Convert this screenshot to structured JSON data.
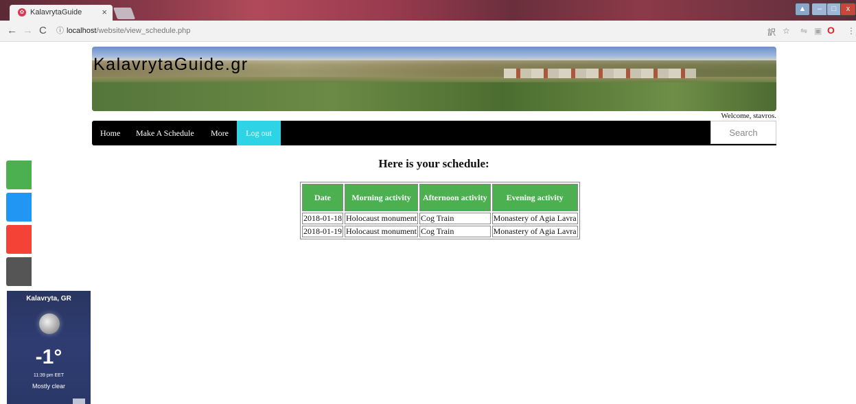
{
  "browser": {
    "tab_title": "KalavrytaGuide",
    "tab_close": "×",
    "url_host": "localhost",
    "url_path": "/website/view_schedule.php"
  },
  "site": {
    "logo": "KalavrytaGuide.gr",
    "welcome": "Welcome, stavros.",
    "nav": {
      "home": "Home",
      "make_schedule": "Make A Schedule",
      "more": "More",
      "logout": "Log out"
    },
    "search_placeholder": "Search"
  },
  "schedule": {
    "heading": "Here is your schedule:",
    "columns": [
      "Date",
      "Morning activity",
      "Afternoon activity",
      "Evening activity"
    ],
    "rows": [
      [
        "2018-01-18",
        "Holocaust monument",
        "Cog Train",
        "Monastery of Agia Lavra"
      ],
      [
        "2018-01-19",
        "Holocaust monument",
        "Cog Train",
        "Monastery of Agia Lavra"
      ]
    ]
  },
  "weather": {
    "location": "Kalavryta, GR",
    "temperature": "-1°",
    "time": "11:39 pm EET",
    "condition": "Mostly clear"
  },
  "colors": {
    "accent_green": "#4caf50",
    "logout_cyan": "#2ed3e6",
    "social": [
      "#4caf50",
      "#2196f3",
      "#f44336",
      "#555555"
    ]
  }
}
